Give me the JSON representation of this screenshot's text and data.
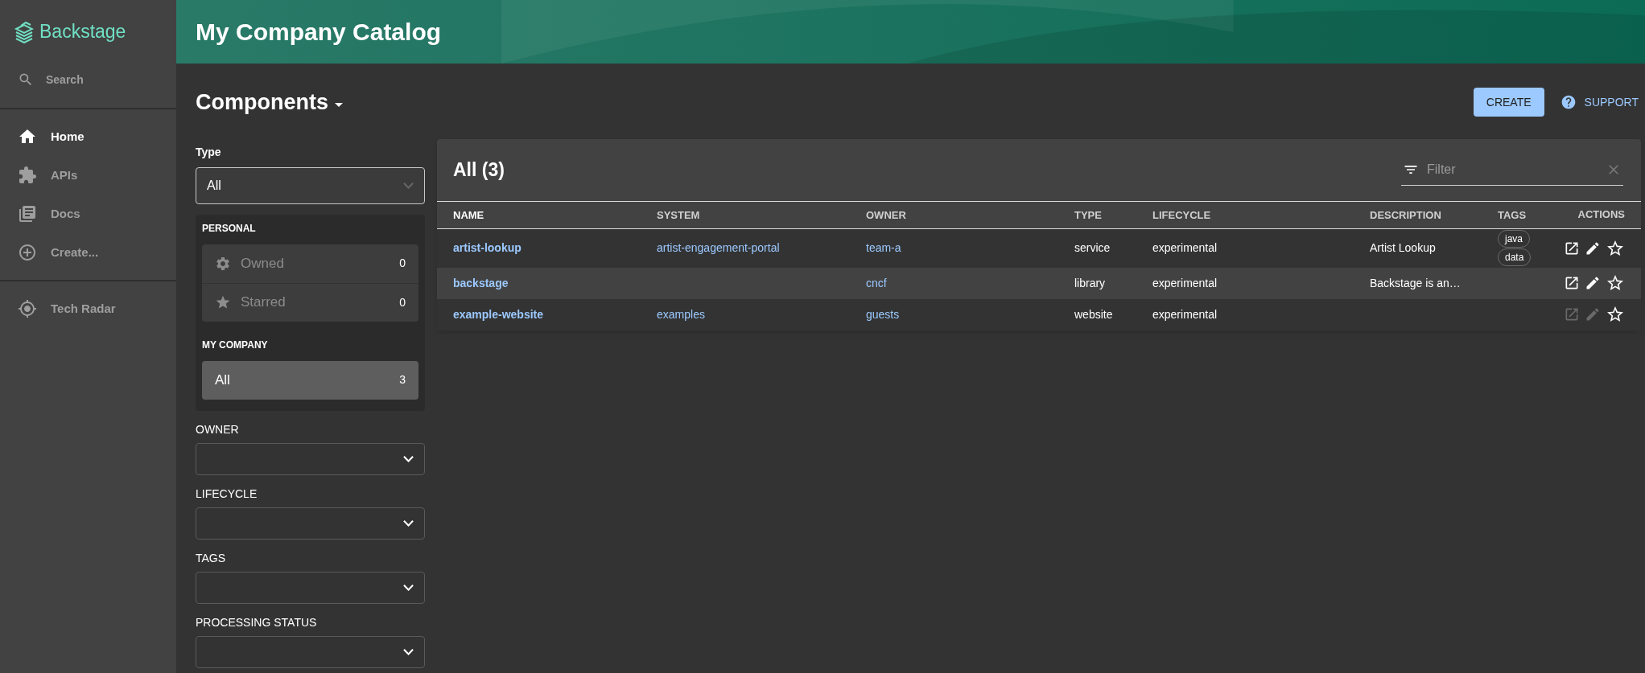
{
  "sidebar": {
    "logo": "Backstage",
    "search": "Search",
    "items": [
      {
        "label": "Home",
        "selected": true
      },
      {
        "label": "APIs",
        "selected": false
      },
      {
        "label": "Docs",
        "selected": false
      },
      {
        "label": "Create...",
        "selected": false
      }
    ],
    "bottom_items": [
      {
        "label": "Tech Radar",
        "selected": false
      }
    ]
  },
  "header": {
    "title": "My Company Catalog"
  },
  "page": {
    "title": "Components",
    "create_button": "CREATE",
    "support_button": "SUPPORT"
  },
  "filters": {
    "type": {
      "label": "Type",
      "value": "All"
    },
    "groups": [
      {
        "title": "PERSONAL",
        "items": [
          {
            "label": "Owned",
            "count": "0",
            "selected": false
          },
          {
            "label": "Starred",
            "count": "0",
            "selected": false
          }
        ]
      },
      {
        "title": "MY COMPANY",
        "items": [
          {
            "label": "All",
            "count": "3",
            "selected": true
          }
        ]
      }
    ],
    "selects": [
      {
        "label": "OWNER"
      },
      {
        "label": "LIFECYCLE"
      },
      {
        "label": "TAGS"
      },
      {
        "label": "PROCESSING STATUS"
      }
    ]
  },
  "table": {
    "title": "All (3)",
    "filter_placeholder": "Filter",
    "columns": [
      "NAME",
      "SYSTEM",
      "OWNER",
      "TYPE",
      "LIFECYCLE",
      "DESCRIPTION",
      "TAGS",
      "ACTIONS"
    ],
    "rows": [
      {
        "name": "artist-lookup",
        "system": "artist-engagement-portal",
        "owner": "team-a",
        "type": "service",
        "lifecycle": "experimental",
        "description": "Artist Lookup",
        "tags": [
          "java",
          "data"
        ],
        "actions_enabled": true,
        "starred": false
      },
      {
        "name": "backstage",
        "owner": "cncf",
        "type": "library",
        "lifecycle": "experimental",
        "description": "Backstage is an…",
        "actions_enabled": true,
        "starred": false
      },
      {
        "name": "example-website",
        "system": "examples",
        "owner": "guests",
        "type": "website",
        "lifecycle": "experimental",
        "actions_enabled": false,
        "starred": false
      }
    ]
  }
}
